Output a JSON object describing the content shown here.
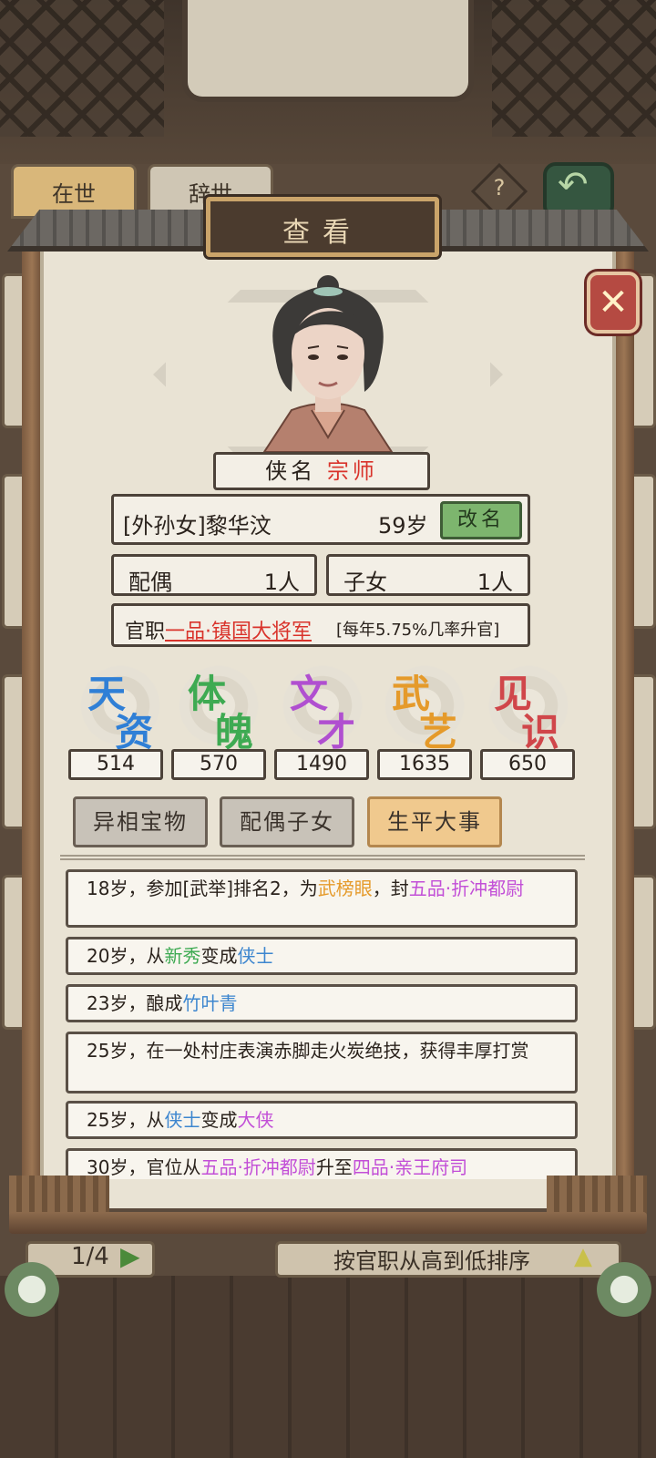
{
  "background": {
    "tabs": [
      "在世",
      "辞世"
    ],
    "help_icon": "?",
    "page_indicator": "1/4",
    "sort_label": "按官职从高到低排序"
  },
  "dialog": {
    "title": "查看",
    "close_icon": "close-x-icon",
    "title_label": "侠名",
    "title_value": "宗师",
    "name": "[外孙女]黎华汶",
    "age": "59岁",
    "rename_button": "改名",
    "spouse_label": "配偶",
    "spouse_count": "1人",
    "children_label": "子女",
    "children_count": "1人",
    "office_label": "官职",
    "office_value": "一品·镇国大将军",
    "office_rate": "[每年5.75%几率升官]"
  },
  "stats": [
    {
      "c1": "天",
      "c2": "资",
      "value": "514",
      "color": "#2f7fd6"
    },
    {
      "c1": "体",
      "c2": "魄",
      "value": "570",
      "color": "#3eaa52"
    },
    {
      "c1": "文",
      "c2": "才",
      "value": "1490",
      "color": "#b04fd0"
    },
    {
      "c1": "武",
      "c2": "艺",
      "value": "1635",
      "color": "#e59a2a"
    },
    {
      "c1": "见",
      "c2": "识",
      "value": "650",
      "color": "#d0464a"
    }
  ],
  "tabs": {
    "treasure": "异相宝物",
    "spouse_children": "配偶子女",
    "life_events": "生平大事"
  },
  "events": [
    {
      "segments": [
        {
          "t": "18岁，参加[武举]排名2，为",
          "c": ""
        },
        {
          "t": "武榜眼",
          "c": "c-orange"
        },
        {
          "t": "，封",
          "c": ""
        },
        {
          "t": "五品·折冲都尉",
          "c": "c-purple"
        }
      ]
    },
    {
      "segments": [
        {
          "t": "20岁，从",
          "c": ""
        },
        {
          "t": "新秀",
          "c": "c-green"
        },
        {
          "t": "变成",
          "c": ""
        },
        {
          "t": "侠士",
          "c": "c-blue"
        }
      ]
    },
    {
      "segments": [
        {
          "t": "23岁，酿成",
          "c": ""
        },
        {
          "t": "竹叶青",
          "c": "c-blue"
        }
      ]
    },
    {
      "segments": [
        {
          "t": "25岁，在一处村庄表演赤脚走火炭绝技，获得丰厚打赏",
          "c": ""
        }
      ]
    },
    {
      "segments": [
        {
          "t": "25岁，从",
          "c": ""
        },
        {
          "t": "侠士",
          "c": "c-blue"
        },
        {
          "t": "变成",
          "c": ""
        },
        {
          "t": "大侠",
          "c": "c-purple"
        }
      ]
    },
    {
      "segments": [
        {
          "t": "30岁，官位从",
          "c": ""
        },
        {
          "t": "五品·折冲都尉",
          "c": "c-purple"
        },
        {
          "t": "升至",
          "c": ""
        },
        {
          "t": "四品·亲王府司",
          "c": "c-purple"
        }
      ]
    }
  ]
}
